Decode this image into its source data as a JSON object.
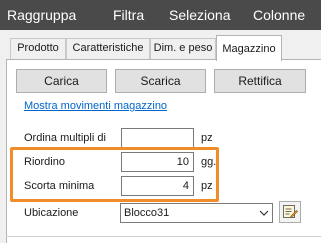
{
  "menubar": {
    "items": [
      "Raggruppa",
      "Filtra",
      "Seleziona",
      "Colonne"
    ]
  },
  "tabs": [
    "Prodotto",
    "Caratteristiche",
    "Dim. e peso",
    "Magazzino"
  ],
  "buttons": {
    "carica": "Carica",
    "scarica": "Scarica",
    "rettifica": "Rettifica"
  },
  "link": "Mostra movimenti magazzino",
  "fields": {
    "ordina_multipli": {
      "label": "Ordina multipli di",
      "value": "",
      "unit": "pz"
    },
    "riordino": {
      "label": "Riordino",
      "value": "10",
      "unit": "gg."
    },
    "scorta_minima": {
      "label": "Scorta minima",
      "value": "4",
      "unit": "pz"
    }
  },
  "ubicazione": {
    "label": "Ubicazione",
    "value": "Blocco31"
  },
  "colors": {
    "menubar_bg": "#4a4a4a",
    "highlight": "#f08c2a",
    "link": "#0066cc"
  },
  "icons": [
    "chevron-down-icon",
    "edit-note-icon"
  ]
}
